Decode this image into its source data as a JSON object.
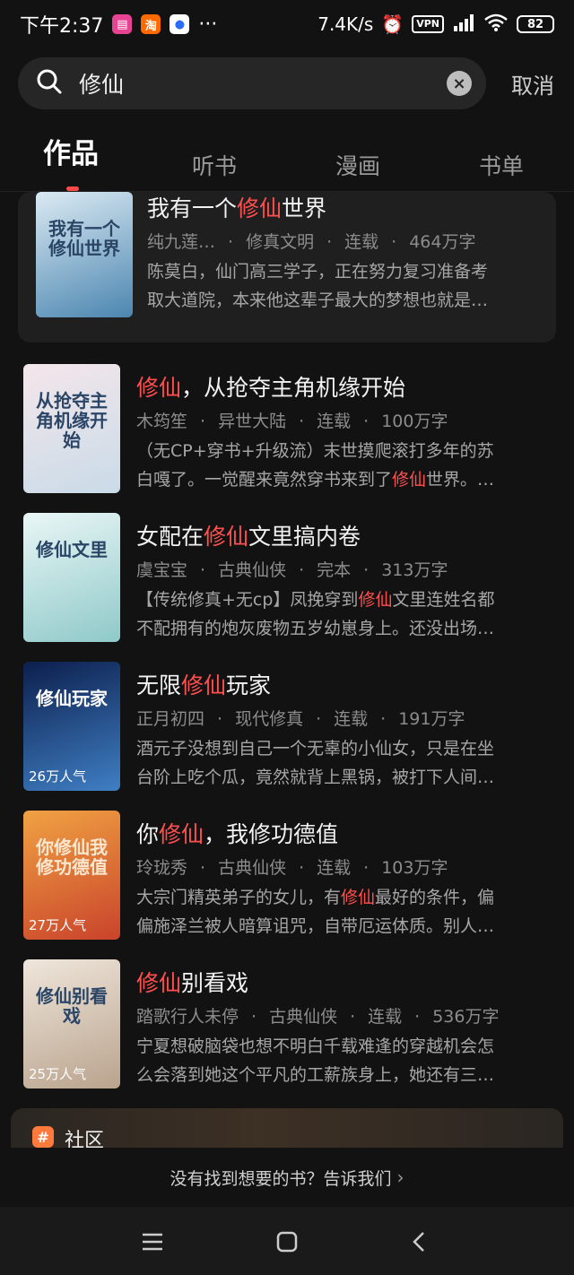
{
  "status_bar": {
    "time": "下午2:37",
    "more": "···",
    "net_speed": "7.4K/s",
    "vpn": "VPN",
    "battery": "82"
  },
  "search": {
    "query": "修仙",
    "cancel": "取消"
  },
  "tabs": [
    "作品",
    "听书",
    "漫画",
    "书单"
  ],
  "books": [
    {
      "title_parts": [
        "我有一个",
        "修仙",
        "世界"
      ],
      "author": "纯九莲…",
      "genre": "修真文明",
      "status": "连载",
      "words": "464万字",
      "desc_lines": [
        "陈莫白，仙门高三学子，正在努力复习准备考",
        "取大道院，本来他这辈子最大的梦想也就是…"
      ],
      "cover_text": "我有一个修仙世界",
      "popularity": "",
      "cover_colors": [
        "#dbeaf3",
        "#4b86b0"
      ]
    },
    {
      "title_parts": [
        "",
        "修仙",
        "，从抢夺主角机缘开始"
      ],
      "author": "木筠笙",
      "genre": "异世大陆",
      "status": "连载",
      "words": "100万字",
      "desc_lines": [
        "（无CP+穿书+升级流）末世摸爬滚打多年的苏",
        "白嘎了。一觉醒来竟然穿书来到了修仙世界。…"
      ],
      "cover_text": "从抢夺主角机缘开始",
      "popularity": "",
      "cover_colors": [
        "#f4e6ea",
        "#c9dbe8"
      ]
    },
    {
      "title_parts": [
        "女配在",
        "修仙",
        "文里搞内卷"
      ],
      "author": "虞宝宝",
      "genre": "古典仙侠",
      "status": "完本",
      "words": "313万字",
      "desc_lines": [
        "【传统修真+无cp】凤挽穿到修仙文里连姓名都",
        "不配拥有的炮灰废物五岁幼崽身上。还没出场…"
      ],
      "cover_text": "修仙文里",
      "popularity": "",
      "cover_colors": [
        "#eaf6f6",
        "#8fc9c9"
      ]
    },
    {
      "title_parts": [
        "无限",
        "修仙",
        "玩家"
      ],
      "author": "正月初四",
      "genre": "现代修真",
      "status": "连载",
      "words": "191万字",
      "desc_lines": [
        "酒元子没想到自己一个无辜的小仙女，只是在坐",
        "台阶上吃个瓜，竟然就背上黑锅，被打下人间…"
      ],
      "cover_text": "修仙玩家",
      "popularity": "26万人气",
      "cover_colors": [
        "#0d1f4d",
        "#3f7fc4"
      ]
    },
    {
      "title_parts": [
        "你",
        "修仙",
        "，我修功德值"
      ],
      "author": "玲珑秀",
      "genre": "古典仙侠",
      "status": "连载",
      "words": "103万字",
      "desc_lines": [
        "大宗门精英弟子的女儿，有修仙最好的条件，偏",
        "偏施泽兰被人暗算诅咒，自带厄运体质。别人…"
      ],
      "cover_text": "你修仙我修功德值",
      "popularity": "27万人气",
      "cover_colors": [
        "#f0a243",
        "#c9432b"
      ]
    },
    {
      "title_parts": [
        "",
        "修仙",
        "别看戏"
      ],
      "author": "踏歌行人未停",
      "genre": "古典仙侠",
      "status": "连载",
      "words": "536万字",
      "desc_lines": [
        "宁夏想破脑袋也想不明白千载难逢的穿越机会怎",
        "么会落到她这个平凡的工薪族身上，她还有三…"
      ],
      "cover_text": "修仙别看戏",
      "popularity": "25万人气",
      "cover_colors": [
        "#efe6db",
        "#b9a38d"
      ]
    }
  ],
  "community": {
    "label": "社区",
    "icon": "#"
  },
  "bottom_tip": {
    "text": "没有找到想要的书？告诉我们"
  },
  "colors": {
    "highlight": "#ff4f4f",
    "background": "#121212"
  },
  "icons": [
    "search-icon",
    "clear-icon",
    "menu-icon",
    "home-icon",
    "back-icon",
    "alarm-icon",
    "wifi-icon",
    "signal-icon"
  ]
}
